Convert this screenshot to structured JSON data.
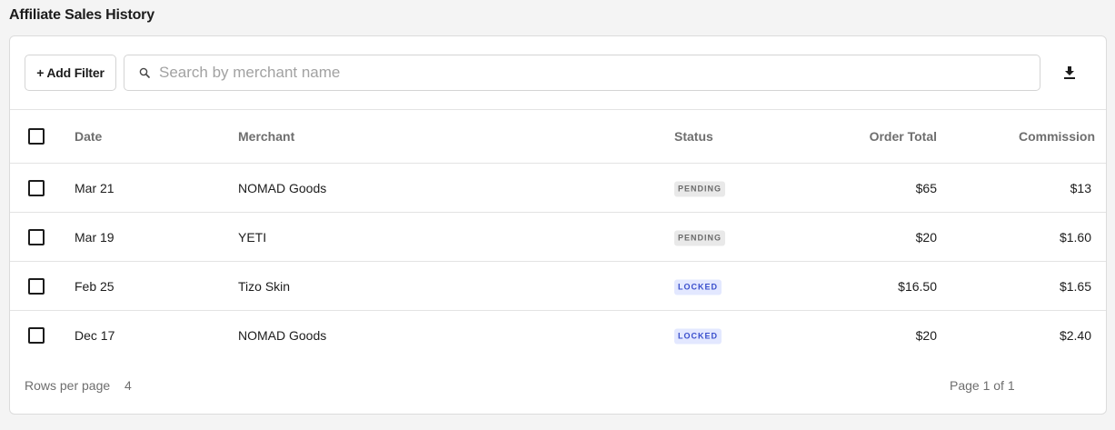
{
  "page": {
    "title": "Affiliate Sales History"
  },
  "toolbar": {
    "add_filter_label": "+ Add Filter",
    "search_placeholder": "Search by merchant name",
    "search_icon": "search-icon",
    "download_icon": "download-icon"
  },
  "table": {
    "headers": {
      "date": "Date",
      "merchant": "Merchant",
      "status": "Status",
      "order_total": "Order Total",
      "commission": "Commission"
    },
    "rows": [
      {
        "date": "Mar 21",
        "merchant": "NOMAD Goods",
        "status": "PENDING",
        "order_total": "$65",
        "commission": "$13"
      },
      {
        "date": "Mar 19",
        "merchant": "YETI",
        "status": "PENDING",
        "order_total": "$20",
        "commission": "$1.60"
      },
      {
        "date": "Feb 25",
        "merchant": "Tizo Skin",
        "status": "LOCKED",
        "order_total": "$16.50",
        "commission": "$1.65"
      },
      {
        "date": "Dec 17",
        "merchant": "NOMAD Goods",
        "status": "LOCKED",
        "order_total": "$20",
        "commission": "$2.40"
      }
    ]
  },
  "footer": {
    "rows_per_page_label": "Rows per page",
    "rows_per_page_value": "4",
    "page_info": "Page 1 of 1"
  },
  "colors": {
    "pending_bg": "#e9e9e9",
    "pending_text": "#6a6a6a",
    "locked_bg": "#e3e8ff",
    "locked_text": "#3a4fcc"
  }
}
